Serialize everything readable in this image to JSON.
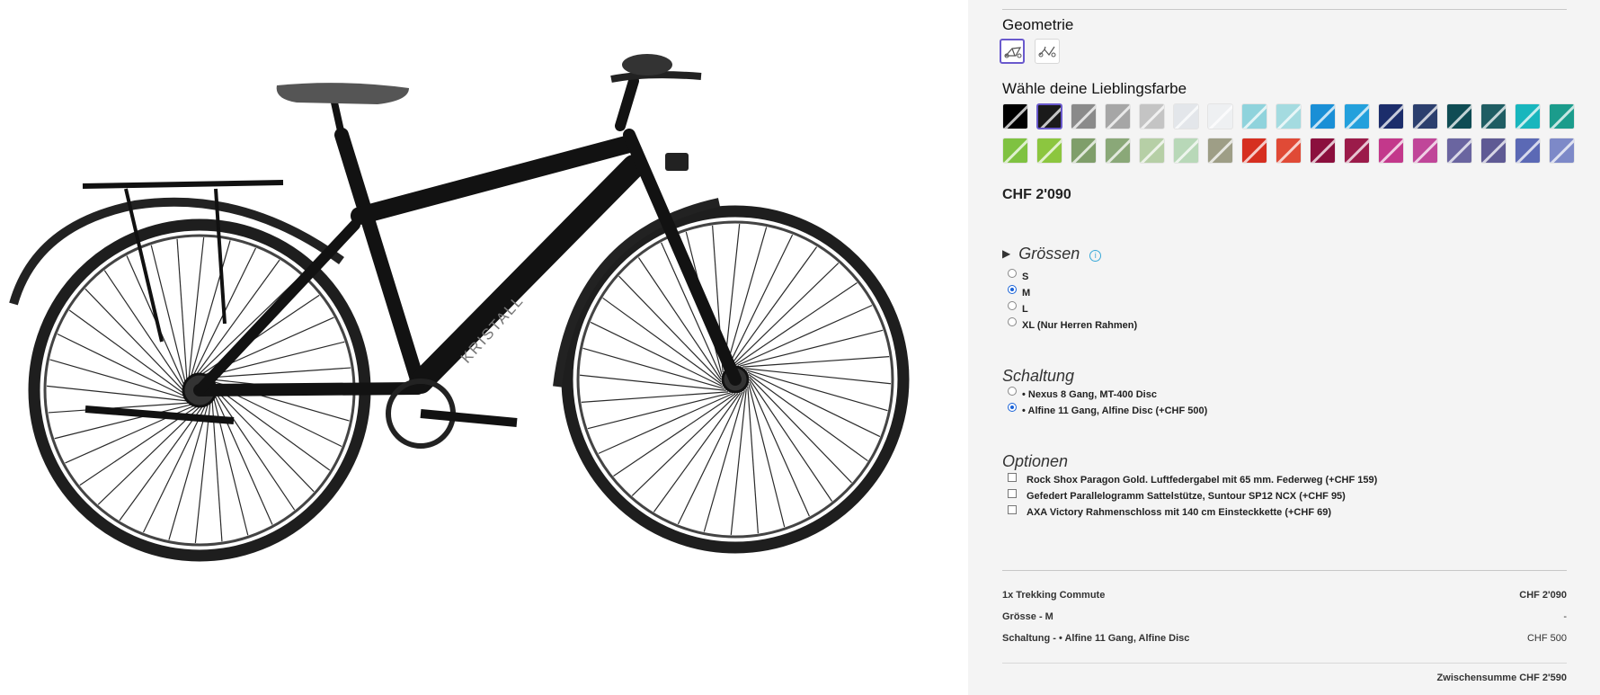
{
  "geometry": {
    "title": "Geometrie"
  },
  "colors": {
    "title": "Wähle deine Lieblingsfarbe",
    "row1": [
      "#000000",
      "#1a1a1a",
      "#8a8a8a",
      "#a6a6a6",
      "#c4c4c4",
      "#e3e6ea",
      "#eef0f2",
      "#8fd3dc",
      "#a4dbe0",
      "#1a8fd6",
      "#23a0dc",
      "#1c2d6b",
      "#2c3f6e",
      "#0f4c54",
      "#1f5d63",
      "#18b6bd",
      "#1b9c8c"
    ],
    "row2": [
      "#7fc241",
      "#8cc63f",
      "#7f9e6a",
      "#8aa878",
      "#b6cfa6",
      "#b8d8b8",
      "#9e9e86",
      "#d62f20",
      "#e04a36",
      "#8b0f3d",
      "#9b1b4a",
      "#c3388b",
      "#c04699",
      "#6a65a0",
      "#5f5a94",
      "#5b69b5",
      "#7d89c8"
    ],
    "selected_index": 1
  },
  "price": "CHF 2'090",
  "sizes": {
    "title": "Grössen",
    "toggle": "▶",
    "items": [
      {
        "label": "S",
        "selected": false
      },
      {
        "label": "M",
        "selected": true
      },
      {
        "label": "L",
        "selected": false
      },
      {
        "label": "XL (Nur Herren Rahmen)",
        "selected": false
      }
    ]
  },
  "shifting": {
    "title": "Schaltung",
    "items": [
      {
        "label": "• Nexus 8 Gang, MT-400 Disc",
        "selected": false
      },
      {
        "label": "• Alfine 11 Gang, Alfine Disc (+CHF 500)",
        "selected": true
      }
    ]
  },
  "options": {
    "title": "Optionen",
    "items": [
      {
        "label": "Rock Shox Paragon Gold. Luftfedergabel mit 65 mm. Federweg (+CHF 159)",
        "checked": false
      },
      {
        "label": "Gefedert Parallelogramm Sattelstütze, Suntour SP12 NCX (+CHF 95)",
        "checked": false
      },
      {
        "label": "AXA Victory Rahmenschloss mit 140 cm Einsteckkette (+CHF 69)",
        "checked": false
      }
    ]
  },
  "summary": {
    "rows": [
      {
        "label": "1x Trekking Commute",
        "value": "CHF 2'090"
      },
      {
        "label": "Grösse - M",
        "value": "-"
      },
      {
        "label": "Schaltung - • Alfine 11 Gang, Alfine Disc",
        "value": "CHF 500"
      }
    ],
    "subtotal": "Zwischensumme CHF 2'590"
  },
  "bike": {
    "brand_text": "KRISTALL"
  }
}
